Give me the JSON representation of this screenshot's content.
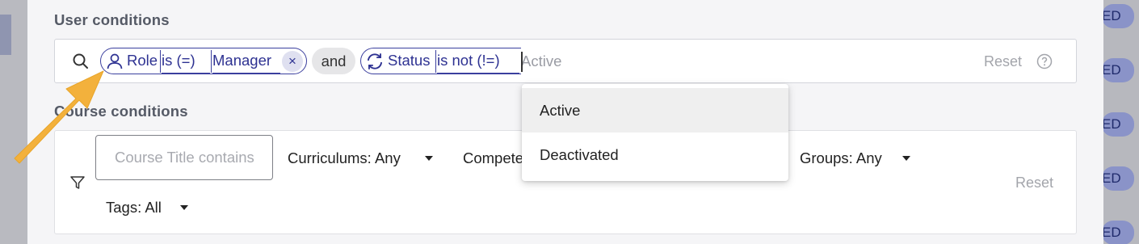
{
  "background": {
    "right_badge_text": "ED"
  },
  "user_conditions": {
    "title": "User conditions",
    "chips": [
      {
        "icon": "user-icon",
        "field": "Role",
        "operator": "is (=)",
        "value": "Manager",
        "removable": true
      },
      {
        "icon": "refresh-icon",
        "field": "Status",
        "operator": "is not (!=)"
      }
    ],
    "connector": "and",
    "remove_symbol": "×",
    "value_placeholder": "Active",
    "reset_label": "Reset"
  },
  "dropdown": {
    "options": [
      "Active",
      "Deactivated"
    ],
    "highlighted": "Active"
  },
  "course_conditions": {
    "title": "Course conditions",
    "title_input_placeholder": "Course Title contains",
    "filters": {
      "curriculums": "Curriculums: Any",
      "competencies": "Competencies: Any",
      "groups": "Groups: Any",
      "tags": "Tags: All"
    },
    "reset_label": "Reset"
  },
  "colors": {
    "chip_accent": "#3b3f9e",
    "annotation_arrow": "#f3b13c"
  }
}
